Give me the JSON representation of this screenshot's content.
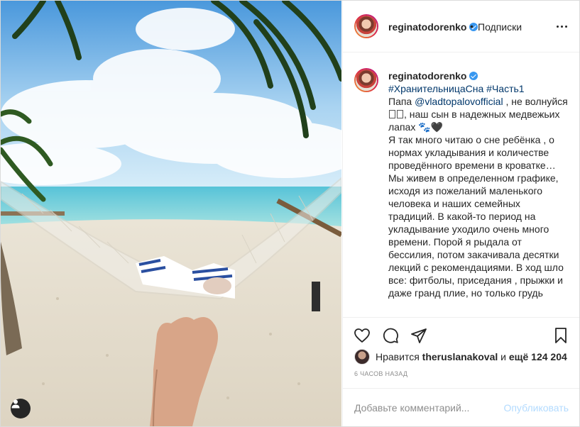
{
  "post": {
    "username": "reginatodorenko",
    "header_separator": "•",
    "follow_status": "Подписки"
  },
  "caption": {
    "username": "reginatodorenko",
    "hashtag1": "#ХранительницаСна",
    "hashtag2": "#Часть1",
    "mention": "@vladtopalovofficial",
    "text_before_mention": "Папа",
    "text_after_mention": ", не волнуйся",
    "text_after_emoji": ", наш сын в надежных медвежьих лапах 🐾🖤",
    "body": "Я так много читаю о сне ребёнка , о нормах укладывания и количестве проведённого времени в кроватке… Мы живем в определенном графике, исходя из пожеланий маленького человека и наших семейных традиций. В какой-то период на укладывание уходило очень много времени. Порой я рыдала от бессилия, потом закачивала десятки лекций с рекомендациями. В ход шло все: фитболы, приседания , прыжки и даже гранд плие, но только грудь"
  },
  "actions": {
    "like_icon": "heart-icon",
    "comment_icon": "comment-icon",
    "share_icon": "share-icon",
    "save_icon": "bookmark-icon"
  },
  "likes": {
    "prefix": "Нравится",
    "user": "theruslanakoval",
    "suffix": "и",
    "count": "ещё 124 204"
  },
  "timestamp": "6 часов назад",
  "comment": {
    "placeholder": "Добавьте комментарий...",
    "publish_label": "Опубликовать"
  },
  "colors": {
    "link": "#00376b",
    "verified": "#3897f0",
    "publish_disabled": "#b3dbff",
    "muted": "#8e8e8e"
  }
}
